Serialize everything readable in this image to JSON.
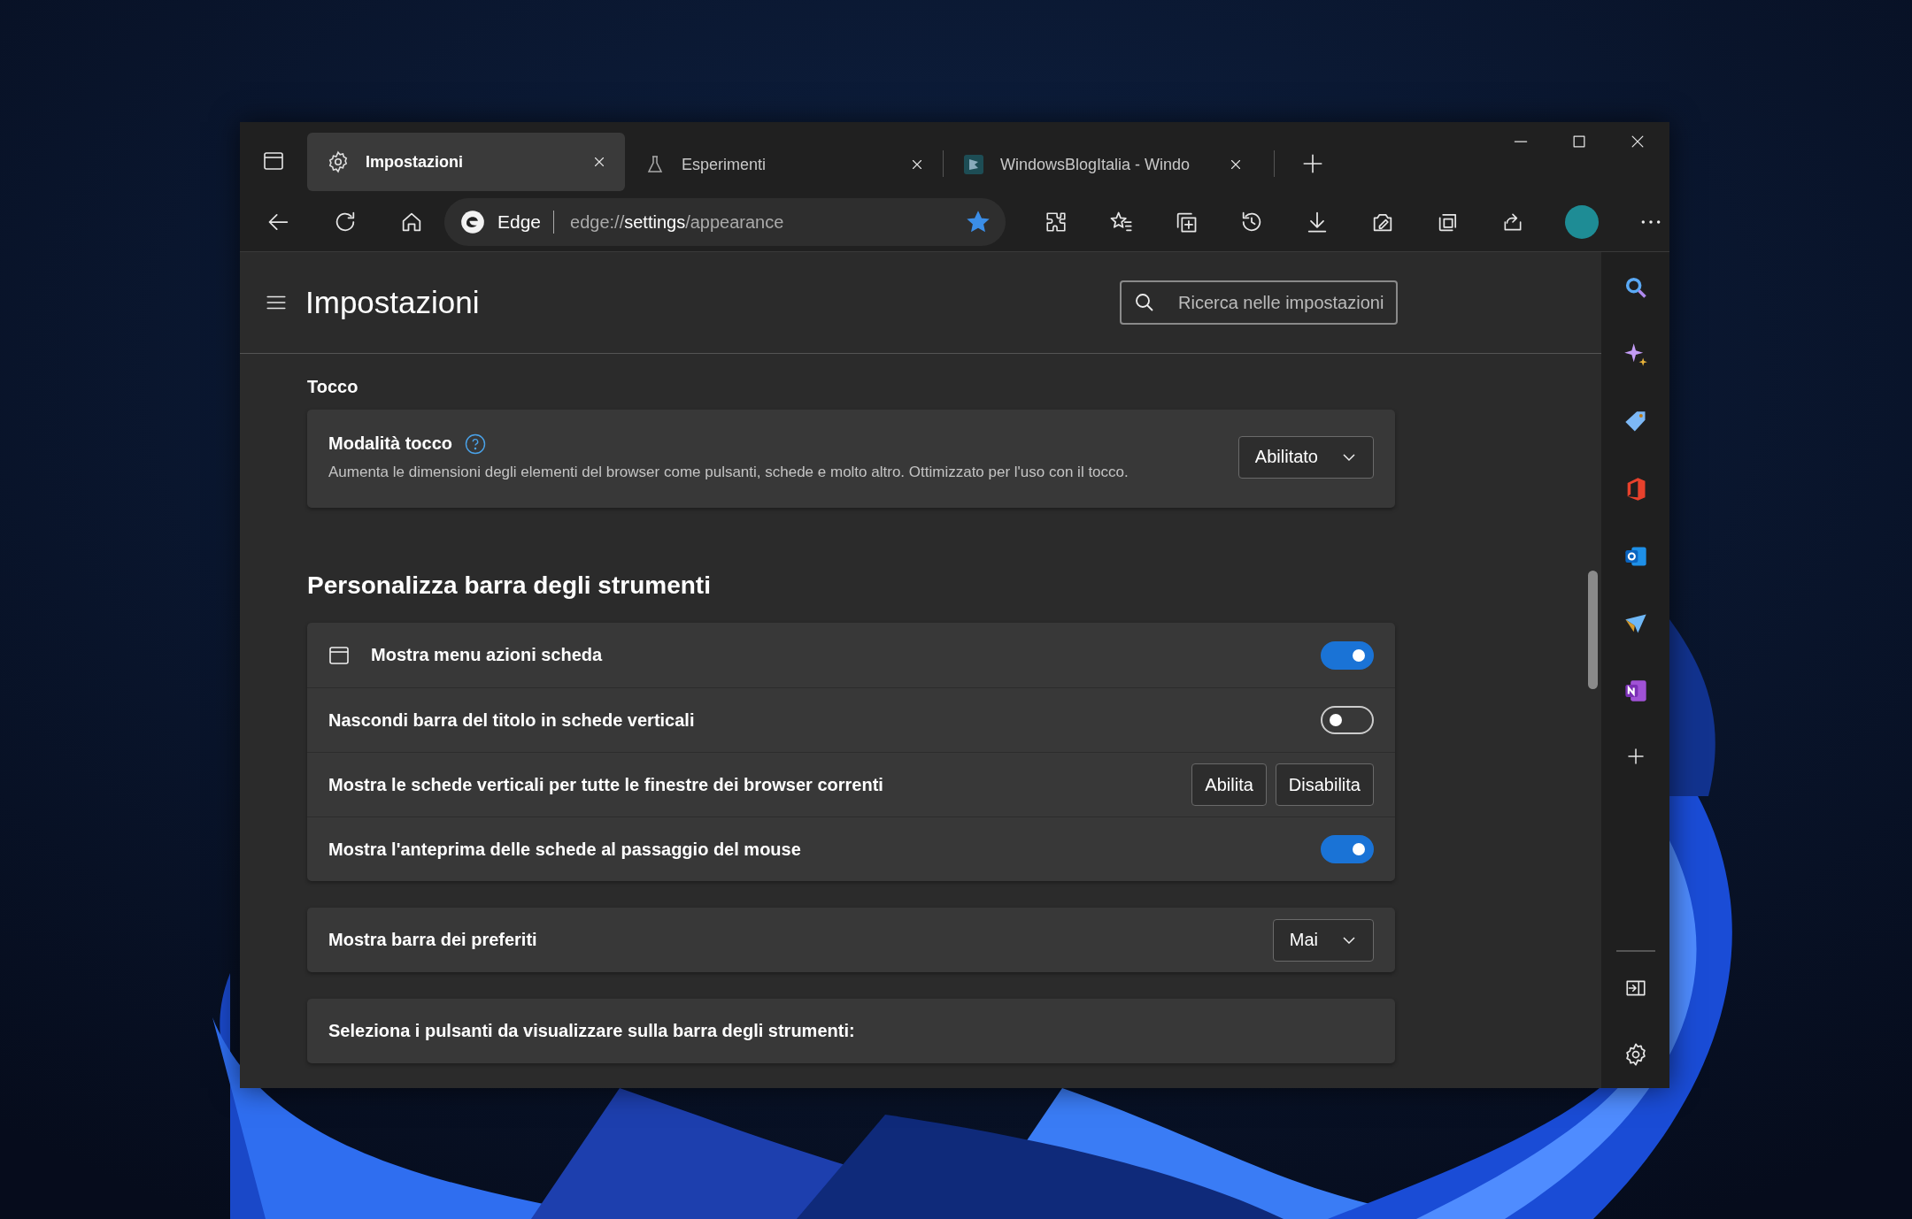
{
  "tabs": [
    {
      "label": "Impostazioni",
      "selected": true,
      "kind": "settings"
    },
    {
      "label": "Esperimenti",
      "selected": false,
      "kind": "flask"
    },
    {
      "label": "WindowsBlogItalia - Windo",
      "selected": false,
      "kind": "site"
    }
  ],
  "address": {
    "brand": "Edge",
    "prefix": "edge://",
    "host": "settings",
    "path": "/appearance",
    "favorite": true
  },
  "settings": {
    "title": "Impostazioni",
    "search": {
      "placeholder": "Ricerca nelle impostazioni"
    },
    "sections": [
      {
        "label": "Tocco",
        "kind": "label",
        "cards": [
          [
            {
              "kind": "dropdown",
              "label": "Modalità tocco",
              "help": true,
              "description": "Aumenta le dimensioni degli elementi del browser come pulsanti, schede e molto altro. Ottimizzato per l'uso con il tocco.",
              "value": "Abilitato"
            }
          ]
        ]
      },
      {
        "label": "Personalizza barra degli strumenti",
        "kind": "heading",
        "cards": [
          [
            {
              "kind": "toggle",
              "label": "Mostra menu azioni scheda",
              "icon": true,
              "on": true
            },
            {
              "kind": "toggle",
              "label": "Nascondi barra del titolo in schede verticali",
              "on": false
            },
            {
              "kind": "buttons",
              "label": "Mostra le schede verticali per tutte le finestre dei browser correnti",
              "buttons": [
                "Abilita",
                "Disabilita"
              ]
            },
            {
              "kind": "toggle",
              "label": "Mostra l'anteprima delle schede al passaggio del mouse",
              "on": true
            }
          ],
          [
            {
              "kind": "dropdown",
              "label": "Mostra barra dei preferiti",
              "value": "Mai"
            }
          ],
          [
            {
              "kind": "heading",
              "label": "Seleziona i pulsanti da visualizzare sulla barra degli strumenti:"
            }
          ]
        ]
      }
    ]
  }
}
